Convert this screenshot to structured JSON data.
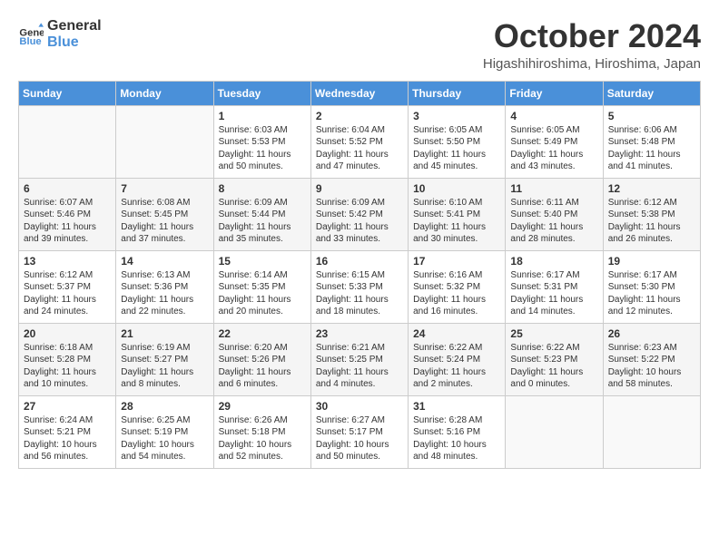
{
  "header": {
    "logo_line1": "General",
    "logo_line2": "Blue",
    "month": "October 2024",
    "location": "Higashihiroshima, Hiroshima, Japan"
  },
  "weekdays": [
    "Sunday",
    "Monday",
    "Tuesday",
    "Wednesday",
    "Thursday",
    "Friday",
    "Saturday"
  ],
  "weeks": [
    [
      {
        "day": "",
        "sunrise": "",
        "sunset": "",
        "daylight": ""
      },
      {
        "day": "",
        "sunrise": "",
        "sunset": "",
        "daylight": ""
      },
      {
        "day": "1",
        "sunrise": "Sunrise: 6:03 AM",
        "sunset": "Sunset: 5:53 PM",
        "daylight": "Daylight: 11 hours and 50 minutes."
      },
      {
        "day": "2",
        "sunrise": "Sunrise: 6:04 AM",
        "sunset": "Sunset: 5:52 PM",
        "daylight": "Daylight: 11 hours and 47 minutes."
      },
      {
        "day": "3",
        "sunrise": "Sunrise: 6:05 AM",
        "sunset": "Sunset: 5:50 PM",
        "daylight": "Daylight: 11 hours and 45 minutes."
      },
      {
        "day": "4",
        "sunrise": "Sunrise: 6:05 AM",
        "sunset": "Sunset: 5:49 PM",
        "daylight": "Daylight: 11 hours and 43 minutes."
      },
      {
        "day": "5",
        "sunrise": "Sunrise: 6:06 AM",
        "sunset": "Sunset: 5:48 PM",
        "daylight": "Daylight: 11 hours and 41 minutes."
      }
    ],
    [
      {
        "day": "6",
        "sunrise": "Sunrise: 6:07 AM",
        "sunset": "Sunset: 5:46 PM",
        "daylight": "Daylight: 11 hours and 39 minutes."
      },
      {
        "day": "7",
        "sunrise": "Sunrise: 6:08 AM",
        "sunset": "Sunset: 5:45 PM",
        "daylight": "Daylight: 11 hours and 37 minutes."
      },
      {
        "day": "8",
        "sunrise": "Sunrise: 6:09 AM",
        "sunset": "Sunset: 5:44 PM",
        "daylight": "Daylight: 11 hours and 35 minutes."
      },
      {
        "day": "9",
        "sunrise": "Sunrise: 6:09 AM",
        "sunset": "Sunset: 5:42 PM",
        "daylight": "Daylight: 11 hours and 33 minutes."
      },
      {
        "day": "10",
        "sunrise": "Sunrise: 6:10 AM",
        "sunset": "Sunset: 5:41 PM",
        "daylight": "Daylight: 11 hours and 30 minutes."
      },
      {
        "day": "11",
        "sunrise": "Sunrise: 6:11 AM",
        "sunset": "Sunset: 5:40 PM",
        "daylight": "Daylight: 11 hours and 28 minutes."
      },
      {
        "day": "12",
        "sunrise": "Sunrise: 6:12 AM",
        "sunset": "Sunset: 5:38 PM",
        "daylight": "Daylight: 11 hours and 26 minutes."
      }
    ],
    [
      {
        "day": "13",
        "sunrise": "Sunrise: 6:12 AM",
        "sunset": "Sunset: 5:37 PM",
        "daylight": "Daylight: 11 hours and 24 minutes."
      },
      {
        "day": "14",
        "sunrise": "Sunrise: 6:13 AM",
        "sunset": "Sunset: 5:36 PM",
        "daylight": "Daylight: 11 hours and 22 minutes."
      },
      {
        "day": "15",
        "sunrise": "Sunrise: 6:14 AM",
        "sunset": "Sunset: 5:35 PM",
        "daylight": "Daylight: 11 hours and 20 minutes."
      },
      {
        "day": "16",
        "sunrise": "Sunrise: 6:15 AM",
        "sunset": "Sunset: 5:33 PM",
        "daylight": "Daylight: 11 hours and 18 minutes."
      },
      {
        "day": "17",
        "sunrise": "Sunrise: 6:16 AM",
        "sunset": "Sunset: 5:32 PM",
        "daylight": "Daylight: 11 hours and 16 minutes."
      },
      {
        "day": "18",
        "sunrise": "Sunrise: 6:17 AM",
        "sunset": "Sunset: 5:31 PM",
        "daylight": "Daylight: 11 hours and 14 minutes."
      },
      {
        "day": "19",
        "sunrise": "Sunrise: 6:17 AM",
        "sunset": "Sunset: 5:30 PM",
        "daylight": "Daylight: 11 hours and 12 minutes."
      }
    ],
    [
      {
        "day": "20",
        "sunrise": "Sunrise: 6:18 AM",
        "sunset": "Sunset: 5:28 PM",
        "daylight": "Daylight: 11 hours and 10 minutes."
      },
      {
        "day": "21",
        "sunrise": "Sunrise: 6:19 AM",
        "sunset": "Sunset: 5:27 PM",
        "daylight": "Daylight: 11 hours and 8 minutes."
      },
      {
        "day": "22",
        "sunrise": "Sunrise: 6:20 AM",
        "sunset": "Sunset: 5:26 PM",
        "daylight": "Daylight: 11 hours and 6 minutes."
      },
      {
        "day": "23",
        "sunrise": "Sunrise: 6:21 AM",
        "sunset": "Sunset: 5:25 PM",
        "daylight": "Daylight: 11 hours and 4 minutes."
      },
      {
        "day": "24",
        "sunrise": "Sunrise: 6:22 AM",
        "sunset": "Sunset: 5:24 PM",
        "daylight": "Daylight: 11 hours and 2 minutes."
      },
      {
        "day": "25",
        "sunrise": "Sunrise: 6:22 AM",
        "sunset": "Sunset: 5:23 PM",
        "daylight": "Daylight: 11 hours and 0 minutes."
      },
      {
        "day": "26",
        "sunrise": "Sunrise: 6:23 AM",
        "sunset": "Sunset: 5:22 PM",
        "daylight": "Daylight: 10 hours and 58 minutes."
      }
    ],
    [
      {
        "day": "27",
        "sunrise": "Sunrise: 6:24 AM",
        "sunset": "Sunset: 5:21 PM",
        "daylight": "Daylight: 10 hours and 56 minutes."
      },
      {
        "day": "28",
        "sunrise": "Sunrise: 6:25 AM",
        "sunset": "Sunset: 5:19 PM",
        "daylight": "Daylight: 10 hours and 54 minutes."
      },
      {
        "day": "29",
        "sunrise": "Sunrise: 6:26 AM",
        "sunset": "Sunset: 5:18 PM",
        "daylight": "Daylight: 10 hours and 52 minutes."
      },
      {
        "day": "30",
        "sunrise": "Sunrise: 6:27 AM",
        "sunset": "Sunset: 5:17 PM",
        "daylight": "Daylight: 10 hours and 50 minutes."
      },
      {
        "day": "31",
        "sunrise": "Sunrise: 6:28 AM",
        "sunset": "Sunset: 5:16 PM",
        "daylight": "Daylight: 10 hours and 48 minutes."
      },
      {
        "day": "",
        "sunrise": "",
        "sunset": "",
        "daylight": ""
      },
      {
        "day": "",
        "sunrise": "",
        "sunset": "",
        "daylight": ""
      }
    ]
  ]
}
